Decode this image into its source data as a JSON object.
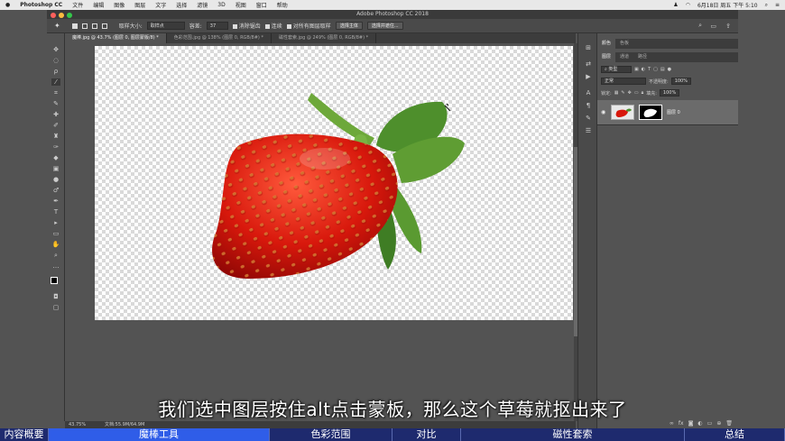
{
  "menubar": {
    "apple": "",
    "items": [
      "Photoshop CC",
      "文件",
      "编辑",
      "图像",
      "图层",
      "文字",
      "选择",
      "滤镜",
      "3D",
      "视图",
      "窗口",
      "帮助"
    ],
    "clock": "6月18日 周五 下午 5:10"
  },
  "window": {
    "title": "Adobe Photoshop CC 2018"
  },
  "options": {
    "sample_size_label": "取样大小:",
    "sample_size_value": "取样点",
    "tolerance_label": "容差:",
    "tolerance_value": "37",
    "antialias_label": "消除锯齿",
    "contiguous_label": "连续",
    "sample_all_label": "对所有图层取样",
    "select_subject": "选择主体",
    "select_mask": "选择并遮住..."
  },
  "tabs": [
    {
      "label": "魔棒.jpg @ 43.7% (图层 0, 图层蒙版/8) *",
      "active": true
    },
    {
      "label": "色彩范围.jpg @ 138% (图层 0, RGB/8#) *",
      "active": false
    },
    {
      "label": "磁性套索.jpg @ 249% (图层 0, RGB/8#) *",
      "active": false
    }
  ],
  "status": {
    "zoom": "43.75%",
    "doc": "文档:55.9M/64.9M"
  },
  "panels": {
    "top_tabs": [
      "颜色",
      "色板"
    ],
    "layer_tabs": [
      "图层",
      "通道",
      "路径"
    ],
    "kind": "类型",
    "blend_mode": "正常",
    "opacity_label": "不透明度:",
    "opacity_value": "100%",
    "lock_label": "锁定:",
    "fill_label": "填充:",
    "fill_value": "100%",
    "layer_name": "图层 0"
  },
  "subtitle": "我们选中图层按住alt点击蒙板，那么这个草莓就抠出来了",
  "chapters": [
    {
      "label": "内容概要",
      "active": false,
      "w": 54
    },
    {
      "label": "魔棒工具",
      "active": true,
      "w": 245
    },
    {
      "label": "色彩范围",
      "active": false,
      "w": 136
    },
    {
      "label": "对比",
      "active": false,
      "w": 76
    },
    {
      "label": "磁性套索",
      "active": false,
      "w": 248
    },
    {
      "label": "总结",
      "active": false,
      "w": 111
    }
  ]
}
